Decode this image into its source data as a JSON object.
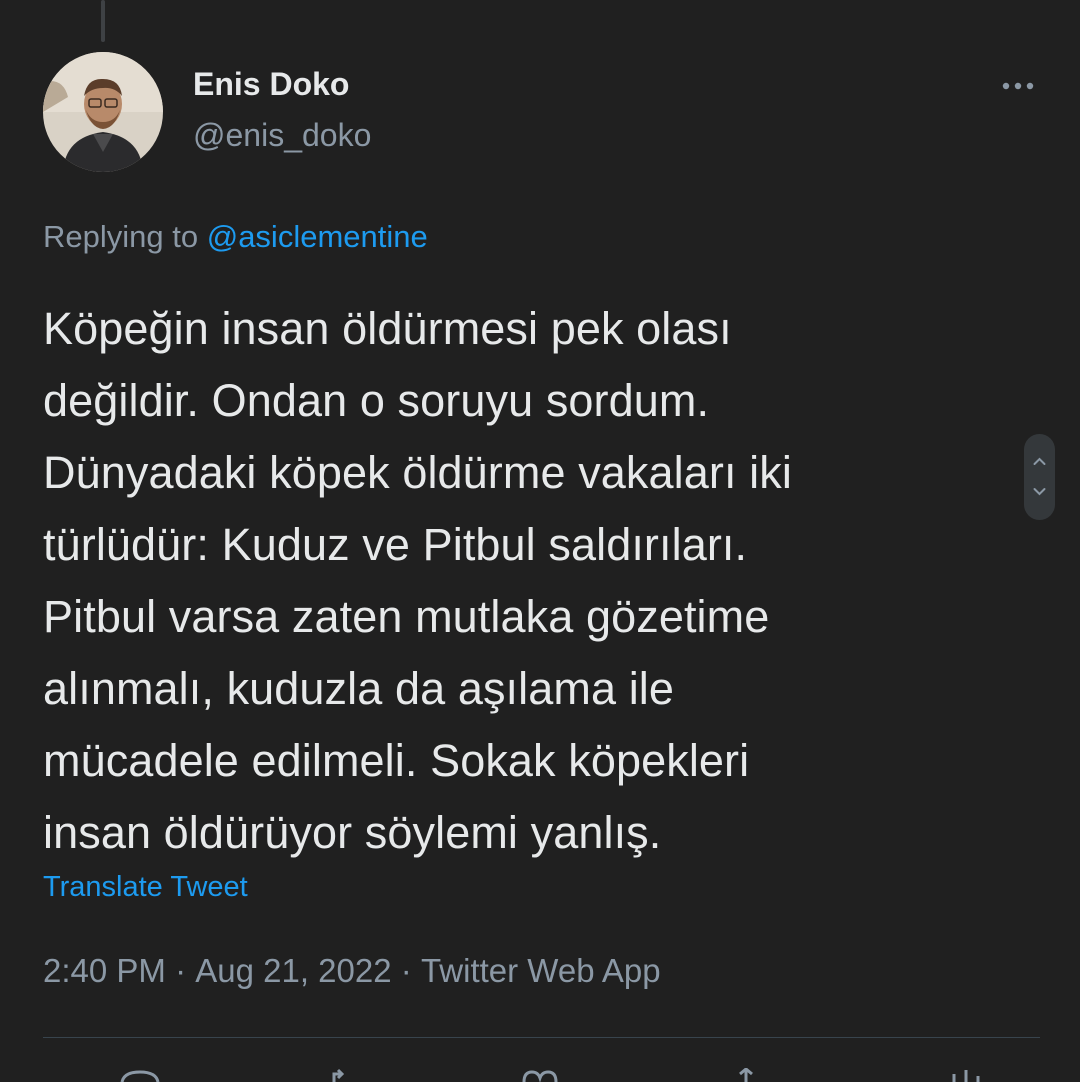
{
  "author": {
    "name": "Enis Doko",
    "handle": "@enis_doko"
  },
  "reply": {
    "prefix": "Replying to",
    "mention": "@asiclementine"
  },
  "tweet": {
    "text": "Köpeğin insan öldürmesi pek olası\ndeğildir. Ondan o soruyu sordum.\nDünyadaki köpek öldürme vakaları iki\ntürlüdür: Kuduz ve Pitbul saldırıları.\nPitbul varsa zaten mutlaka gözetime\nalınmalı, kuduzla da aşılama ile\nmücadele edilmeli. Sokak köpekleri\ninsan öldürüyor söylemi yanlış.",
    "translate_label": "Translate Tweet"
  },
  "meta": {
    "time": "2:40 PM",
    "separator": "·",
    "date": "Aug 21, 2022",
    "source": "Twitter Web App"
  },
  "icons": {
    "more": "more-horizontal-icon",
    "scroll": "scroll-up-down-icon",
    "actions": [
      "reply-icon",
      "retweet-icon",
      "like-icon",
      "share-icon"
    ]
  },
  "colors": {
    "background": "#202020",
    "text": "#e7e9ea",
    "secondary": "#8b98a5",
    "accent": "#1d9bf0"
  }
}
